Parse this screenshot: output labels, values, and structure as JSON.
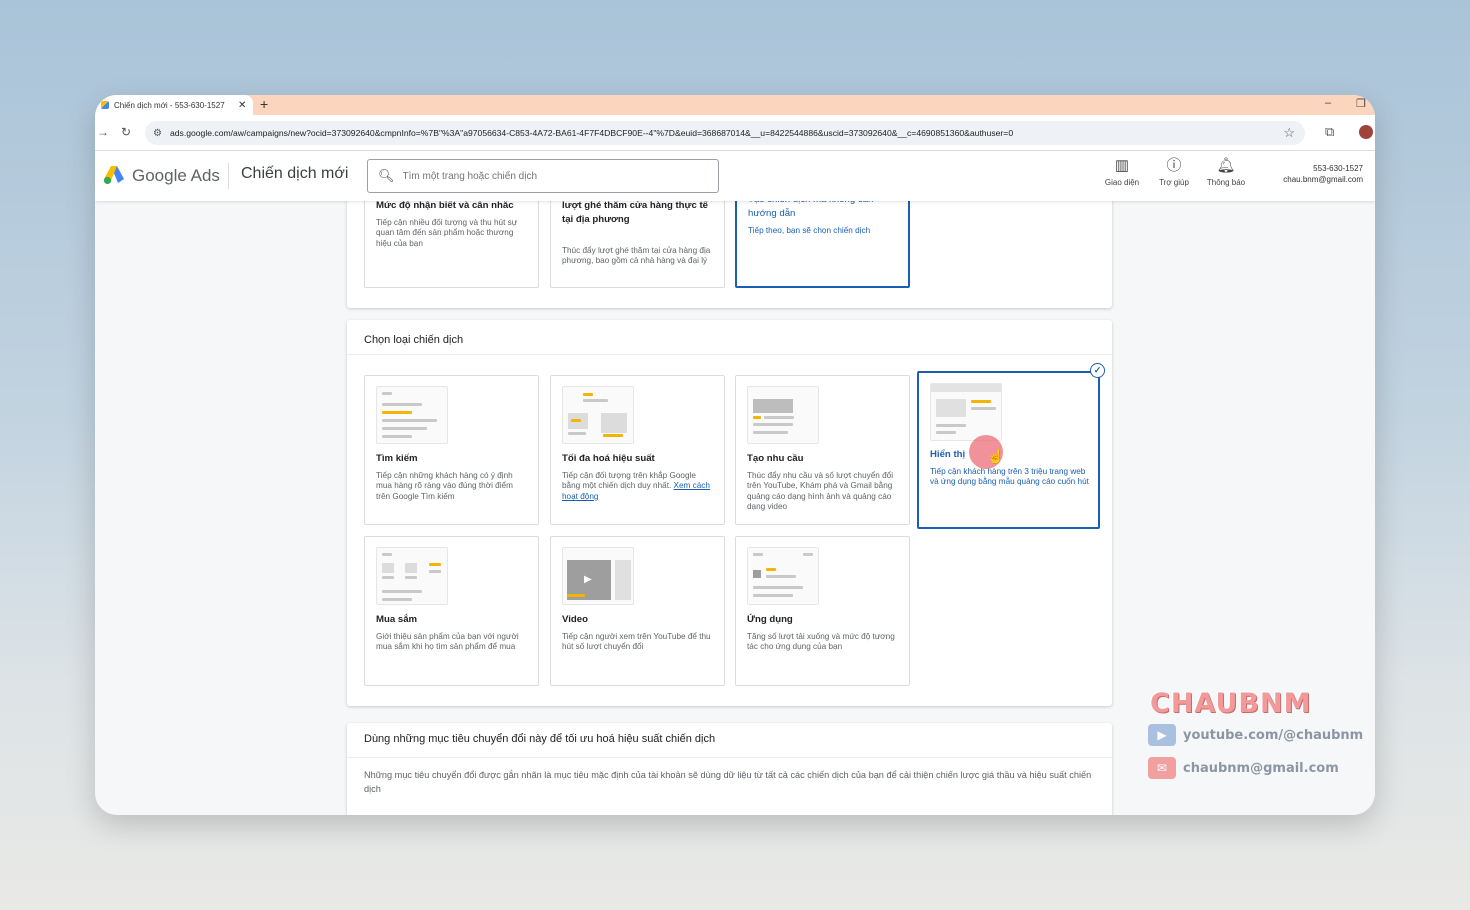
{
  "browser": {
    "tab_title": "Chiến dịch mới - 553-630-1527",
    "tab_close": "✕",
    "new_tab": "+",
    "minimize": "–",
    "restore": "❐",
    "url": "ads.google.com/aw/campaigns/new?ocid=373092640&cmpnInfo=%7B\"%3A\"a97056634-C853-4A72-BA61-4F7F4DBCF90E--4\"%7D&euid=368687014&__u=8422544886&uscid=373092640&__c=4690851360&authuser=0"
  },
  "header": {
    "brand": "Google Ads",
    "page_title": "Chiến dịch mới",
    "search_placeholder": "Tìm một trang hoặc chiến dịch",
    "buttons": [
      {
        "label": "Giao diện",
        "icon": "layout-icon"
      },
      {
        "label": "Trợ giúp",
        "icon": "help-icon"
      },
      {
        "label": "Thông báo",
        "icon": "bell-icon"
      }
    ],
    "account_id": "553-630-1527",
    "account_email": "chau.bnm@gmail.com"
  },
  "goals": [
    {
      "title": "Mức độ nhận biết và cân nhắc",
      "desc": "Tiếp cận nhiều đối tượng và thu hút sự quan tâm đến sản phẩm hoặc thương hiệu của bạn"
    },
    {
      "title": "Chương trình khuyến mại và lượt ghé thăm cửa hàng thực tế tại địa phương",
      "desc": "Thúc đẩy lượt ghé thăm tại cửa hàng địa phương, bao gồm cả nhà hàng và đại lý"
    },
    {
      "title": "Tạo chiến dịch mà không cần hướng dẫn",
      "desc": "Tiếp theo, bạn sẽ chọn chiến dịch"
    }
  ],
  "campaign_types": {
    "section_title": "Chọn loại chiến dịch",
    "items": [
      {
        "title": "Tìm kiếm",
        "desc": "Tiếp cận những khách hàng có ý định mua hàng rõ ràng vào đúng thời điểm trên Google Tìm kiếm"
      },
      {
        "title": "Tối đa hoá hiệu suất",
        "desc": "Tiếp cận đối tượng trên khắp Google bằng một chiến dịch duy nhất.",
        "link": "Xem cách hoạt động"
      },
      {
        "title": "Tạo nhu cầu",
        "desc": "Thúc đẩy nhu cầu và số lượt chuyển đổi trên YouTube, Khám phá và Gmail bằng quảng cáo dạng hình ảnh và quảng cáo dạng video"
      },
      {
        "title": "Hiển thị",
        "desc": "Tiếp cận khách hàng trên 3 triệu trang web và ứng dụng bằng mẫu quảng cáo cuốn hút",
        "selected": true
      },
      {
        "title": "Mua sắm",
        "desc": "Giới thiệu sản phẩm của bạn với người mua sắm khi họ tìm sản phẩm để mua"
      },
      {
        "title": "Video",
        "desc": "Tiếp cận người xem trên YouTube để thu hút số lượt chuyển đổi"
      },
      {
        "title": "Ứng dụng",
        "desc": "Tăng số lượt tải xuống và mức độ tương tác cho ứng dụng của bạn"
      }
    ]
  },
  "conversion": {
    "title": "Dùng những mục tiêu chuyển đổi này để tối ưu hoá hiệu suất chiến dịch",
    "desc": "Những mục tiêu chuyển đổi được gắn nhãn là mục tiêu mặc định của tài khoản sẽ dùng dữ liệu từ tất cả các chiến dịch của bạn để cải thiện chiến lược giá thầu và hiệu suất chiến dịch"
  },
  "watermark": {
    "name": "CHAUBNM",
    "youtube": "youtube.com/@chaubnm",
    "email": "chaubnm@gmail.com"
  },
  "colors": {
    "accent": "#1a5fb4",
    "tabbar": "#fbd5bd",
    "watermark": "#f29a9a"
  }
}
